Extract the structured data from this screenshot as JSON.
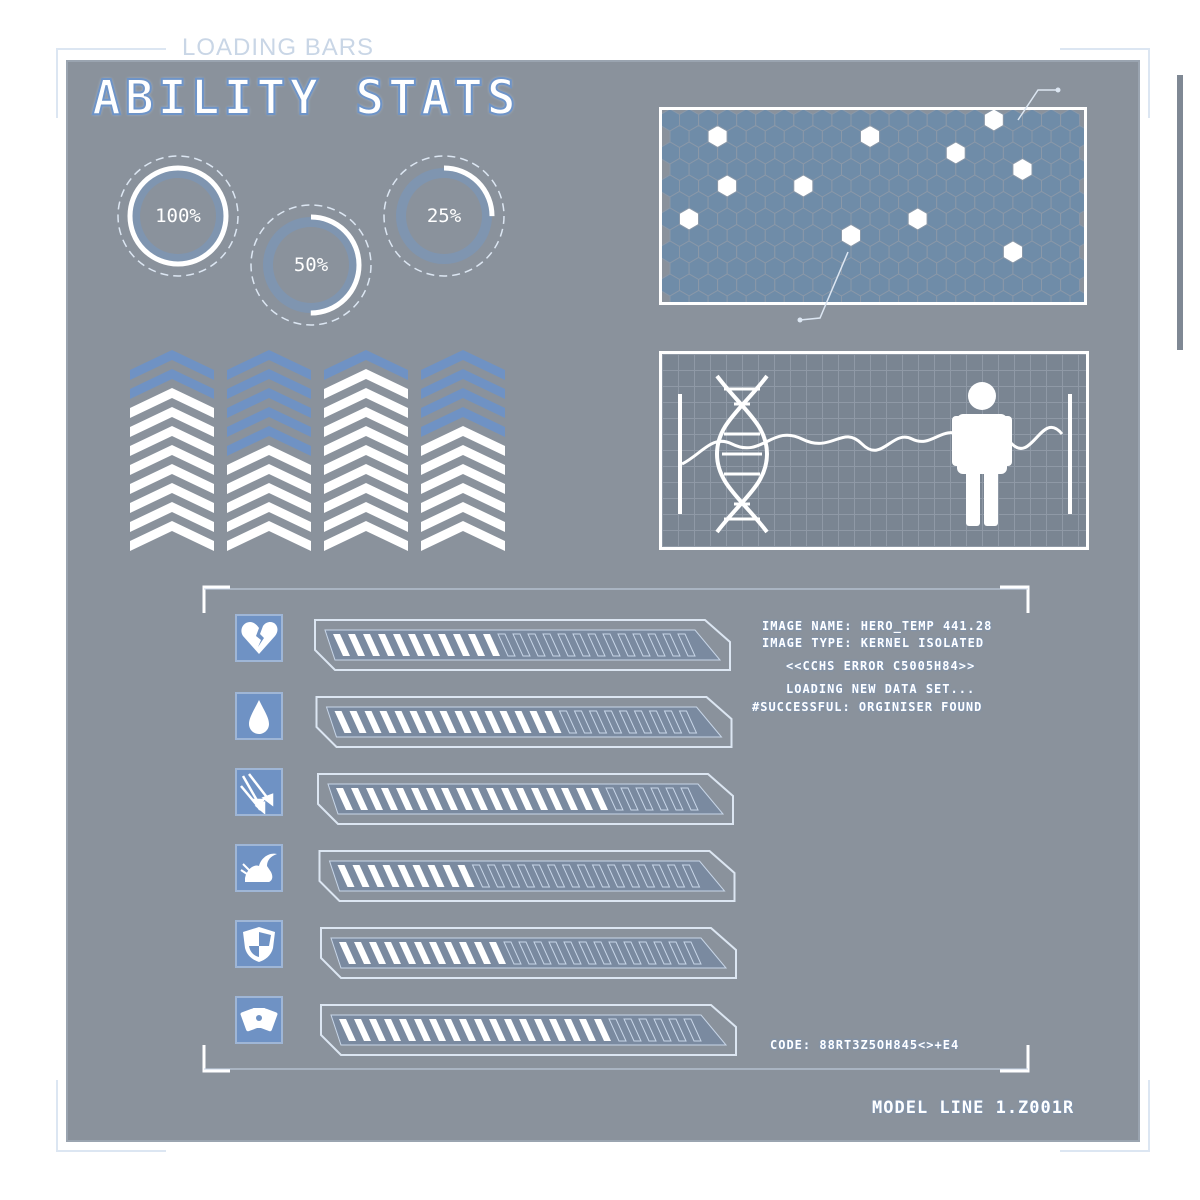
{
  "header": {
    "tag": "LOADING BARS",
    "title": "ABILITY STATS"
  },
  "rings": [
    {
      "label": "100%",
      "value": 1.0
    },
    {
      "label": "50%",
      "value": 0.5
    },
    {
      "label": "25%",
      "value": 0.25
    }
  ],
  "colors": {
    "panel": "#8a929c",
    "accent": "#6f92c4",
    "white": "#ffffff",
    "hex": "#6f8ca8"
  },
  "info": {
    "lines": [
      "IMAGE NAME:  HERO_TEMP 441.28",
      "IMAGE TYPE: KERNEL ISOLATED",
      "<<CCHS ERROR C5005H84>>",
      "LOADING NEW DATA SET...",
      "#SUCCESSFUL: ORGINISER FOUND"
    ],
    "code": "CODE: 88RT3Z5OH845<>+E4",
    "model": "MODEL LINE 1.Z001R"
  },
  "stats": [
    {
      "icon": "broken-heart-icon",
      "value": 0.45
    },
    {
      "icon": "water-drop-icon",
      "value": 0.62
    },
    {
      "icon": "arrows-icon",
      "value": 0.75
    },
    {
      "icon": "winged-foot-icon",
      "value": 0.38
    },
    {
      "icon": "shield-icon",
      "value": 0.45
    },
    {
      "icon": "playing-cards-icon",
      "value": 0.75
    }
  ],
  "chevron_columns": [
    {
      "blue": 2
    },
    {
      "blue": 5
    },
    {
      "blue": 1
    },
    {
      "blue": 4
    }
  ]
}
